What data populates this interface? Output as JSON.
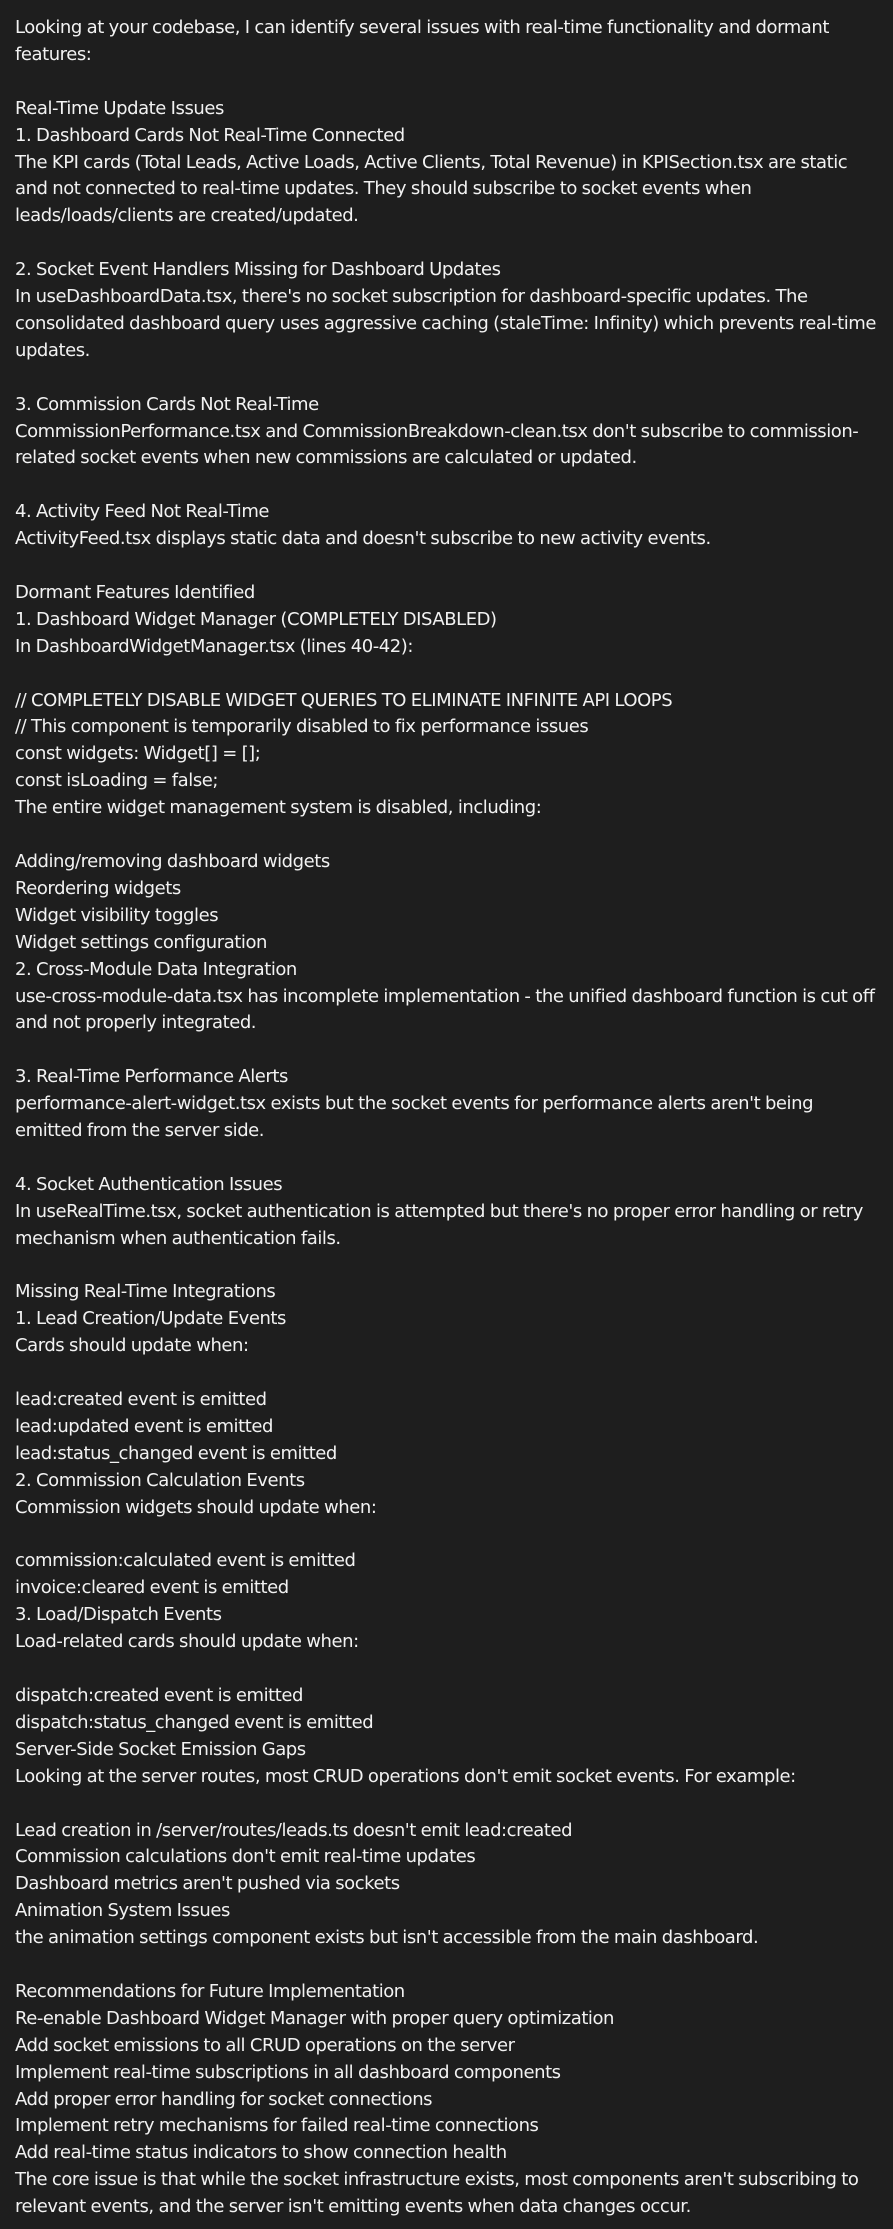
{
  "document": {
    "lines": [
      "Looking at your codebase, I can identify several issues with real-time functionality and dormant features:",
      "",
      "Real-Time Update Issues",
      "1. Dashboard Cards Not Real-Time Connected",
      "The KPI cards (Total Leads, Active Loads, Active Clients, Total Revenue) in KPISection.tsx are static and not connected to real-time updates. They should subscribe to socket events when leads/loads/clients are created/updated.",
      "",
      "2. Socket Event Handlers Missing for Dashboard Updates",
      "In useDashboardData.tsx, there's no socket subscription for dashboard-specific updates. The consolidated dashboard query uses aggressive caching (staleTime: Infinity) which prevents real-time updates.",
      "",
      "3. Commission Cards Not Real-Time",
      "CommissionPerformance.tsx and CommissionBreakdown-clean.tsx don't subscribe to commission-related socket events when new commissions are calculated or updated.",
      "",
      "4. Activity Feed Not Real-Time",
      "ActivityFeed.tsx displays static data and doesn't subscribe to new activity events.",
      "",
      "Dormant Features Identified",
      "1. Dashboard Widget Manager (COMPLETELY DISABLED)",
      "In DashboardWidgetManager.tsx (lines 40-42):",
      "",
      "// COMPLETELY DISABLE WIDGET QUERIES TO ELIMINATE INFINITE API LOOPS",
      "// This component is temporarily disabled to fix performance issues",
      "const widgets: Widget[] = [];",
      "const isLoading = false;",
      "The entire widget management system is disabled, including:",
      "",
      "Adding/removing dashboard widgets",
      "Reordering widgets",
      "Widget visibility toggles",
      "Widget settings configuration",
      "2. Cross-Module Data Integration",
      "use-cross-module-data.tsx has incomplete implementation - the unified dashboard function is cut off and not properly integrated.",
      "",
      "3. Real-Time Performance Alerts",
      "performance-alert-widget.tsx exists but the socket events for performance alerts aren't being emitted from the server side.",
      "",
      "4. Socket Authentication Issues",
      "In useRealTime.tsx, socket authentication is attempted but there's no proper error handling or retry mechanism when authentication fails.",
      "",
      "Missing Real-Time Integrations",
      "1. Lead Creation/Update Events",
      "Cards should update when:",
      "",
      "lead:created event is emitted",
      "lead:updated event is emitted",
      "lead:status_changed event is emitted",
      "2. Commission Calculation Events",
      "Commission widgets should update when:",
      "",
      "commission:calculated event is emitted",
      "invoice:cleared event is emitted",
      "3. Load/Dispatch Events",
      "Load-related cards should update when:",
      "",
      "dispatch:created event is emitted",
      "dispatch:status_changed event is emitted",
      "Server-Side Socket Emission Gaps",
      "Looking at the server routes, most CRUD operations don't emit socket events. For example:",
      "",
      "Lead creation in /server/routes/leads.ts doesn't emit lead:created",
      "Commission calculations don't emit real-time updates",
      "Dashboard metrics aren't pushed via sockets",
      "Animation System Issues",
      " the animation settings component exists but isn't accessible from the main dashboard.",
      "",
      "Recommendations for Future Implementation",
      "Re-enable Dashboard Widget Manager with proper query optimization",
      "Add socket emissions to all CRUD operations on the server",
      "Implement real-time subscriptions in all dashboard components",
      "Add proper error handling for socket connections",
      "Implement retry mechanisms for failed real-time connections",
      "Add real-time status indicators to show connection health",
      "The core issue is that while the socket infrastructure exists, most components aren't subscribing to relevant events, and the server isn't emitting events when data changes occur."
    ]
  }
}
